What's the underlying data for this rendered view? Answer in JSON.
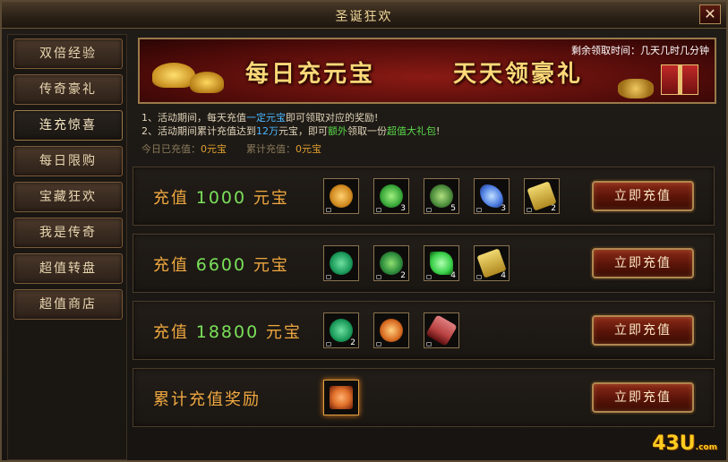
{
  "window": {
    "title": "圣诞狂欢",
    "close_label": "✕"
  },
  "sidebar": {
    "items": [
      {
        "label": "双倍经验",
        "active": false
      },
      {
        "label": "传奇豪礼",
        "active": false
      },
      {
        "label": "连充惊喜",
        "active": true
      },
      {
        "label": "每日限购",
        "active": false
      },
      {
        "label": "宝藏狂欢",
        "active": false
      },
      {
        "label": "我是传奇",
        "active": false
      },
      {
        "label": "超值转盘",
        "active": false
      },
      {
        "label": "超值商店",
        "active": false
      }
    ]
  },
  "banner": {
    "title_left": "每日充元宝",
    "title_right": "天天领豪礼",
    "remaining_label": "剩余领取时间：",
    "remaining_value": "几天几时几分钟"
  },
  "description": {
    "line1_prefix": "1、活动期间，每天充值",
    "line1_highlight": "一定元宝",
    "line1_suffix": "即可领取对应的奖励!",
    "line2_prefix": "2、活动期间累计充值达到",
    "line2_highlight": "12万",
    "line2_mid": "元宝，即可",
    "line2_highlight2": "额外",
    "line2_mid2": "领取一份",
    "line2_highlight3": "超值大礼包",
    "line2_suffix": "!"
  },
  "stats": {
    "today_label": "今日已充值：",
    "today_value": "0元宝",
    "total_label": "累计充值：",
    "total_value": "0元宝"
  },
  "tiers": [
    {
      "prefix": "充值",
      "amount": "1000",
      "suffix": "元宝",
      "button": "立即充值",
      "items": [
        {
          "icon": "orange-orb-icon",
          "color": "#d08a20",
          "count": ""
        },
        {
          "icon": "green-gem-icon",
          "color": "#3aa83a",
          "count": "3"
        },
        {
          "icon": "green-dragon-orb-icon",
          "color": "#4a8a3a",
          "count": "5"
        },
        {
          "icon": "blue-wing-icon",
          "color": "#4a7ae0",
          "count": "3"
        },
        {
          "icon": "gold-scroll-icon",
          "color": "#d8b040",
          "count": "2"
        }
      ]
    },
    {
      "prefix": "充值",
      "amount": "6600",
      "suffix": "元宝",
      "button": "立即充值",
      "items": [
        {
          "icon": "emerald-gem-icon",
          "color": "#1a9a5a",
          "count": ""
        },
        {
          "icon": "green-orb-stand-icon",
          "color": "#2a8a3a",
          "count": "2"
        },
        {
          "icon": "green-crystal-icon",
          "color": "#3ad04a",
          "count": "4"
        },
        {
          "icon": "gold-scroll-icon",
          "color": "#d8b040",
          "count": "4"
        }
      ]
    },
    {
      "prefix": "充值",
      "amount": "18800",
      "suffix": "元宝",
      "button": "立即充值",
      "items": [
        {
          "icon": "emerald-gem-icon",
          "color": "#1a9a5a",
          "count": "2"
        },
        {
          "icon": "fire-orb-icon",
          "color": "#d86a20",
          "count": ""
        },
        {
          "icon": "red-scroll-icon",
          "color": "#b84040",
          "count": ""
        }
      ]
    },
    {
      "prefix": "累计充值奖励",
      "amount": "",
      "suffix": "",
      "button": "立即充值",
      "items": [
        {
          "icon": "gift-box-icon",
          "color": "#e0702a",
          "count": ""
        }
      ]
    }
  ],
  "logo": {
    "text": "43U",
    "suffix": ".com"
  }
}
